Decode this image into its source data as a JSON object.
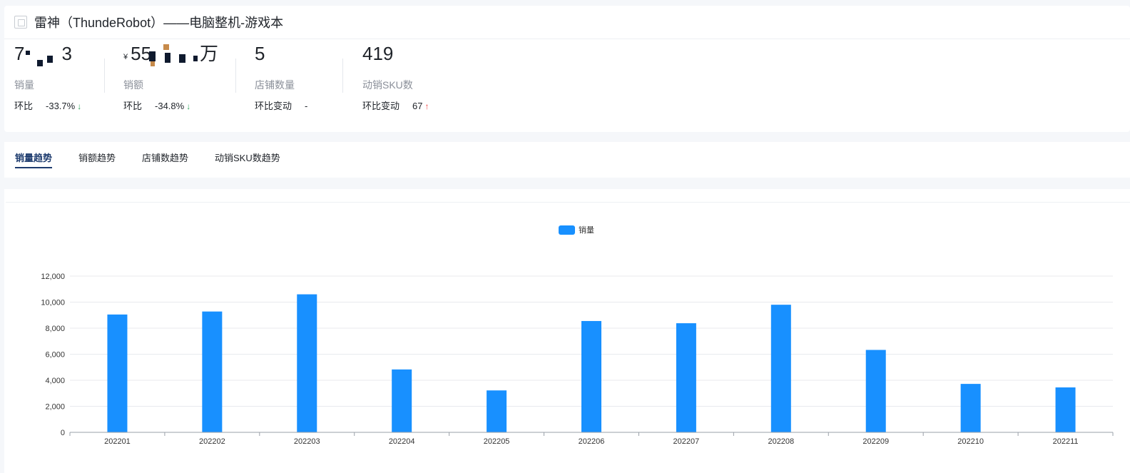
{
  "header": {
    "icon": "image-placeholder-icon",
    "title": "雷神（ThundeRobot）——电脑整机-游戏本"
  },
  "metrics": [
    {
      "value_prefix": "",
      "value": "7",
      "value_suffix": "3",
      "label": "销量",
      "change_key": "环比",
      "change_value": "-33.7%",
      "direction": "down"
    },
    {
      "value_prefix": "¥",
      "value": "55",
      "value_suffix": "万",
      "label": "销额",
      "change_key": "环比",
      "change_value": "-34.8%",
      "direction": "down"
    },
    {
      "value_prefix": "",
      "value": "5",
      "value_suffix": "",
      "label": "店铺数量",
      "change_key": "环比变动",
      "change_value": "-",
      "direction": "none"
    },
    {
      "value_prefix": "",
      "value": "419",
      "value_suffix": "",
      "label": "动销SKU数",
      "change_key": "环比变动",
      "change_value": "67",
      "direction": "up"
    }
  ],
  "tabs": [
    {
      "label": "销量趋势",
      "active": true
    },
    {
      "label": "销额趋势",
      "active": false
    },
    {
      "label": "店铺数趋势",
      "active": false
    },
    {
      "label": "动销SKU数趋势",
      "active": false
    }
  ],
  "colors": {
    "bar": "#1890ff",
    "up": "#f04a4a",
    "down": "#2ea35a",
    "active_tab": "#1d3b6e"
  },
  "chart_data": {
    "type": "bar",
    "legend": [
      "销量"
    ],
    "categories": [
      "202201",
      "202202",
      "202203",
      "202204",
      "202205",
      "202206",
      "202207",
      "202208",
      "202209",
      "202210",
      "202211"
    ],
    "series": [
      {
        "name": "销量",
        "values": [
          9050,
          9280,
          10600,
          4830,
          3220,
          8550,
          8380,
          9800,
          6330,
          3720,
          3450
        ]
      }
    ],
    "ylim": [
      0,
      12000
    ],
    "yticks": [
      "0",
      "2,000",
      "4,000",
      "6,000",
      "8,000",
      "10,000",
      "12,000"
    ],
    "grid": true,
    "legend_position": "top-center"
  }
}
